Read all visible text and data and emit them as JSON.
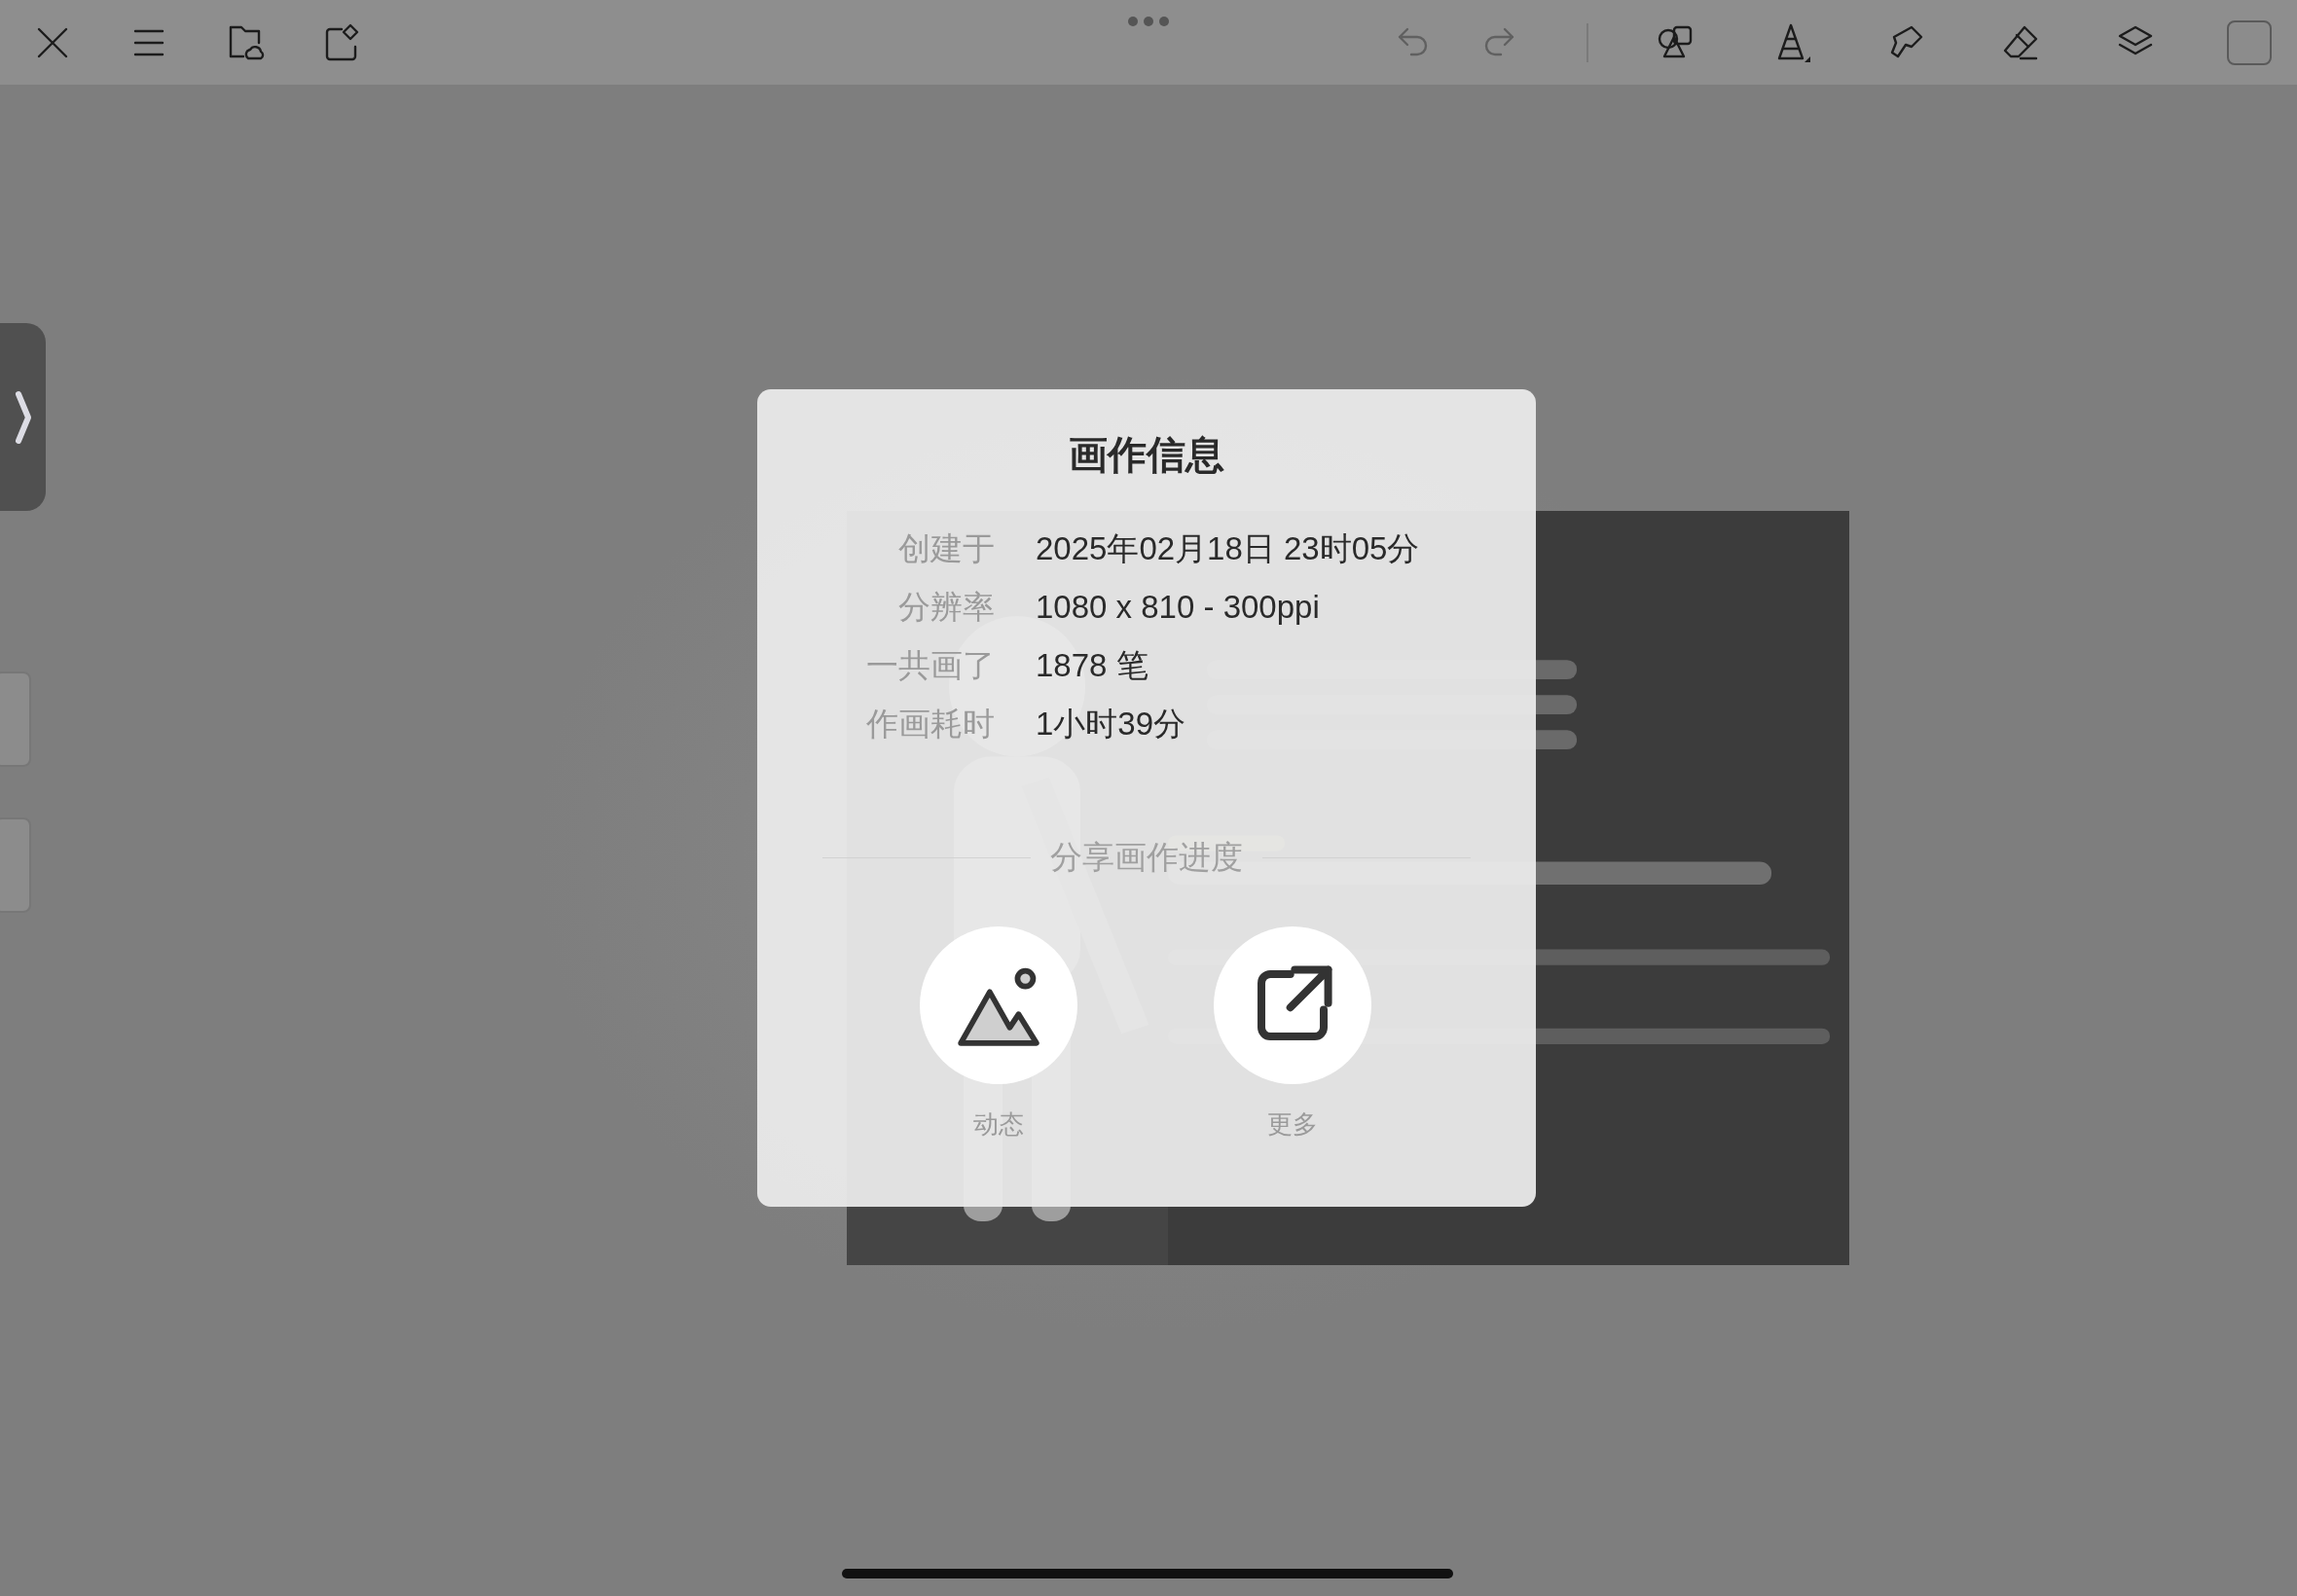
{
  "toolbar": {
    "left": [
      {
        "kind": "close"
      },
      {
        "kind": "menu"
      },
      {
        "kind": "folder"
      },
      {
        "kind": "adjust"
      }
    ],
    "right": [
      {
        "kind": "undo",
        "disabled": true
      },
      {
        "kind": "redo",
        "disabled": true
      },
      {
        "kind": "divider"
      },
      {
        "kind": "shapes"
      },
      {
        "kind": "pen"
      },
      {
        "kind": "smudge"
      },
      {
        "kind": "eraser"
      },
      {
        "kind": "layers"
      },
      {
        "kind": "swatch"
      }
    ]
  },
  "dialog": {
    "title": "画作信息",
    "rows": [
      {
        "label": "创建于",
        "value": "2025年02月18日 23时05分"
      },
      {
        "label": "分辨率",
        "value": "1080 x 810 - 300ppi"
      },
      {
        "label": "一共画了",
        "value": "1878 笔"
      },
      {
        "label": "作画耗时",
        "value": "1小时39分"
      }
    ],
    "share_title": "分享画作进度",
    "share_buttons": [
      {
        "kind": "moments",
        "label": "动态"
      },
      {
        "kind": "more",
        "label": "更多"
      }
    ]
  }
}
